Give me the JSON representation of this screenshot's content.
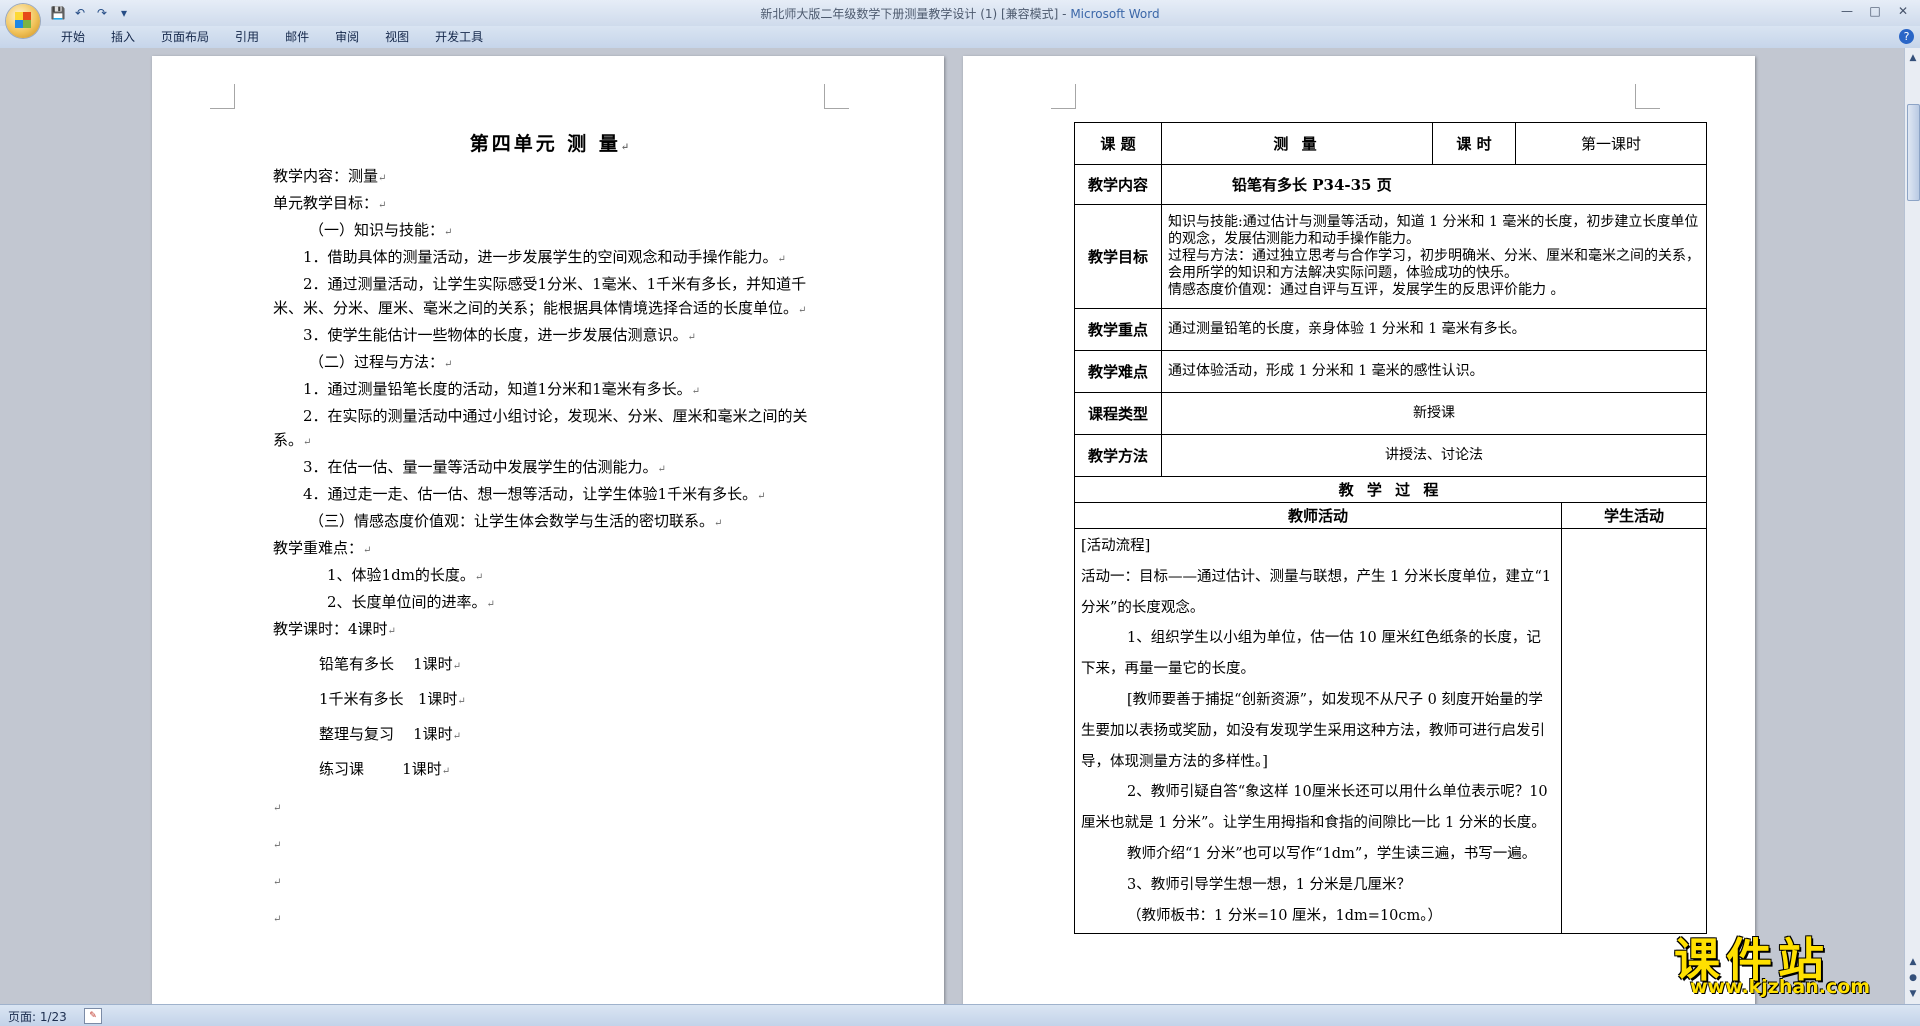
{
  "window": {
    "title": "新北师大版二年级数学下册测量教学设计 (1) [兼容模式] - ",
    "app_name": "Microsoft Word",
    "controls": [
      "—",
      "□",
      "✕"
    ]
  },
  "quick_access": [
    {
      "name": "save-icon",
      "glyph": "💾"
    },
    {
      "name": "undo-icon",
      "glyph": "↶"
    },
    {
      "name": "redo-icon",
      "glyph": "↷"
    },
    {
      "name": "customize-icon",
      "glyph": "▾"
    }
  ],
  "ribbon": {
    "tabs": [
      "开始",
      "插入",
      "页面布局",
      "引用",
      "邮件",
      "审阅",
      "视图",
      "开发工具"
    ],
    "help": "?"
  },
  "left_page": {
    "title": "第四单元    测        量",
    "paragraphs": [
      {
        "text": "教学内容：测量",
        "style": ""
      },
      {
        "text": "单元教学目标：",
        "style": ""
      },
      {
        "text": "（一）知识与技能：",
        "style": "in1"
      },
      {
        "text": "1．借助具体的测量活动，进一步发展学生的空间观念和动手操作能力。",
        "style": "ind"
      },
      {
        "text": "2．通过测量活动，让学生实际感受1分米、1毫米、1千米有多长，并知道千米、米、分米、厘米、毫米之间的关系；能根据具体情境选择合适的长度单位。",
        "style": "ind"
      },
      {
        "text": "3．使学生能估计一些物体的长度，进一步发展估测意识。",
        "style": "ind"
      },
      {
        "text": "（二）过程与方法：",
        "style": "in1"
      },
      {
        "text": "1．通过测量铅笔长度的活动，知道1分米和1毫米有多长。",
        "style": "ind"
      },
      {
        "text": "2．在实际的测量活动中通过小组讨论，发现米、分米、厘米和毫米之间的关系。",
        "style": "ind"
      },
      {
        "text": "3．在估一估、量一量等活动中发展学生的估测能力。",
        "style": "ind"
      },
      {
        "text": "4．通过走一走、估一估、想一想等活动，让学生体验1千米有多长。",
        "style": "ind"
      },
      {
        "text": "（三）情感态度价值观：让学生体会数学与生活的密切联系。",
        "style": "in1"
      },
      {
        "text": "教学重难点：",
        "style": ""
      },
      {
        "text": "1、体验1dm的长度。",
        "style": "in3"
      },
      {
        "text": "2、长度单位间的进率。",
        "style": "in3"
      },
      {
        "text": "教学课时：4课时",
        "style": ""
      }
    ],
    "hours": [
      "铅笔有多长    1课时",
      "1千米有多长   1课时",
      "整理与复习    1课时",
      "练习课        1课时"
    ]
  },
  "right_page": {
    "topic_label": "课    题",
    "topic_value": "测    量",
    "hour_label": "课    时",
    "hour_value": "第一课时",
    "content_label": "教学内容",
    "content_value": "铅笔有多长 P34-35 页",
    "goal_label": "教学目标",
    "goals": [
      "知识与技能:通过估计与测量等活动，知道 1 分米和 1 毫米的长度，初步建立长度单位的观念，发展估测能力和动手操作能力。",
      "过程与方法：通过独立思考与合作学习，初步明确米、分米、厘米和毫米之间的关系，会用所学的知识和方法解决实际问题，体验成功的快乐。",
      "情感态度价值观：通过自评与互评，发展学生的反思评价能力  。"
    ],
    "key_label": "教学重点",
    "key_value": "通过测量铅笔的长度，亲身体验 1 分米和 1 毫米有多长。",
    "diff_label": "教学难点",
    "diff_value": "通过体验活动，形成 1 分米和 1 毫米的感性认识。",
    "type_label": "课程类型",
    "type_value": "新授课",
    "method_label": "教学方法",
    "method_value": "讲授法、讨论法",
    "process_title": "教 学 过 程",
    "teacher_col": "教师活动",
    "student_col": "学生活动",
    "process": [
      {
        "text": "[活动流程]",
        "style": ""
      },
      {
        "text": "活动一：目标——通过估计、测量与联想，产生 1 分米长度单位，建立“1 分米”的长度观念。",
        "style": ""
      },
      {
        "text": "1、组织学生以小组为单位，估一估 10 厘米红色纸条的长度，记下来，再量一量它的长度。",
        "style": "i2"
      },
      {
        "text": "[教师要善于捕捉“创新资源”，如发现不从尺子 0 刻度开始量的学生要加以表扬或奖励，如没有发现学生采用这种方法，教师可进行启发引导，体现测量方法的多样性。]",
        "style": "i2"
      },
      {
        "text": "2、教师引疑自答“象这样 10厘米长还可以用什么单位表示呢？10 厘米也就是 1 分米”。让学生用拇指和食指的间隙比一比 1 分米的长度。",
        "style": "i2"
      },
      {
        "text": "教师介绍“1 分米”也可以写作“1dm”，学生读三遍，书写一遍。",
        "style": "i2"
      },
      {
        "text": "3、教师引导学生想一想，1 分米是几厘米？",
        "style": "i2"
      },
      {
        "text": "（教师板书：1 分米=10 厘米，1dm=10cm。）",
        "style": "i2"
      }
    ]
  },
  "status": {
    "page": "页面: 1/23"
  },
  "watermark": {
    "main": "课件站",
    "url": "www.kjzhan.com"
  }
}
